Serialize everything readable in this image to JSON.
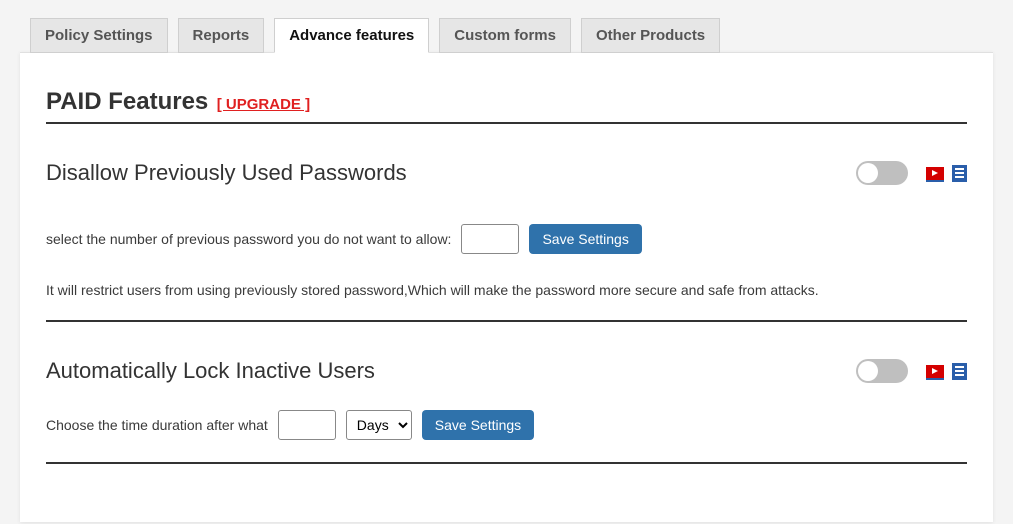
{
  "tabs": [
    {
      "label": "Policy Settings"
    },
    {
      "label": "Reports"
    },
    {
      "label": "Advance features"
    },
    {
      "label": "Custom forms"
    },
    {
      "label": "Other Products"
    }
  ],
  "active_tab_index": 2,
  "page_title": "PAID Features",
  "upgrade_label": "[ UPGRADE ]",
  "sections": [
    {
      "title": "Disallow Previously Used Passwords",
      "toggle_on": false,
      "input_label": "select the number of previous password you do not want to allow:",
      "input_value": "",
      "save_button": "Save Settings",
      "description": "It will restrict users from using previously stored password,Which will make the password more secure and safe from attacks."
    },
    {
      "title": "Automatically Lock Inactive Users",
      "toggle_on": false,
      "input_label": "Choose the time duration after what",
      "input_value": "",
      "unit_selected": "Days",
      "unit_options": [
        "Days"
      ],
      "save_button": "Save Settings"
    }
  ]
}
